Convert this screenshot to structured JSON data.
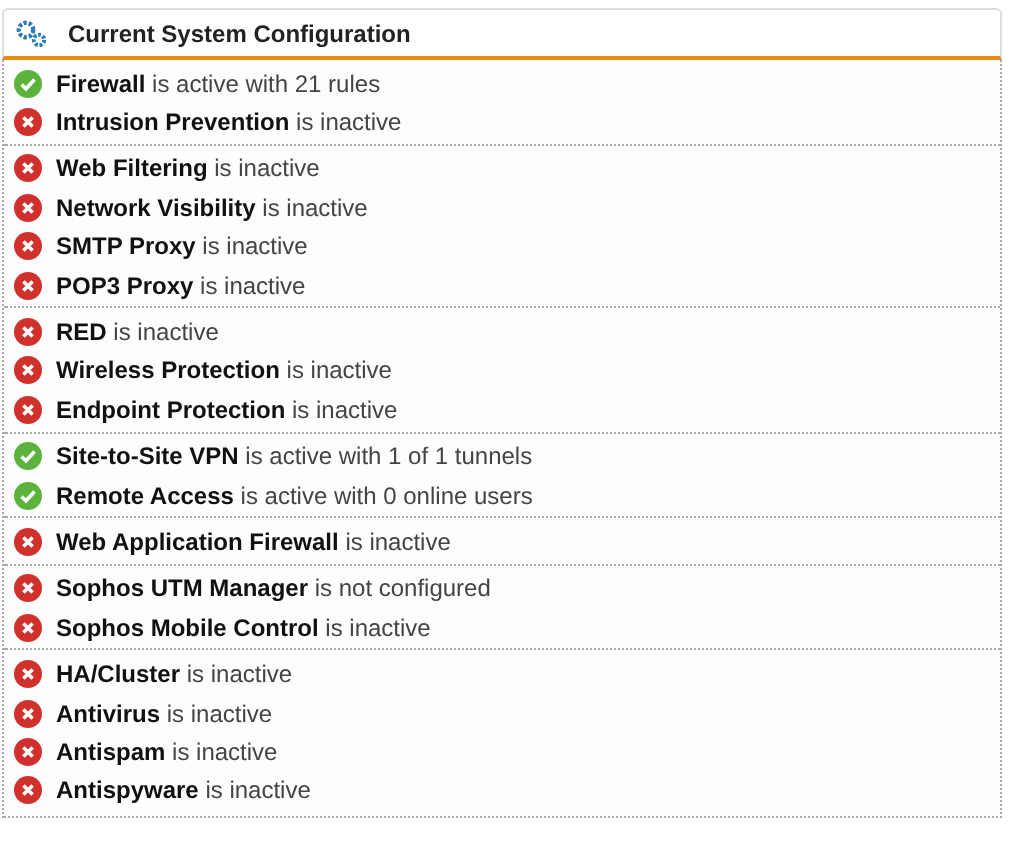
{
  "panel": {
    "title": "Current System Configuration"
  },
  "groups": [
    {
      "items": [
        {
          "text": "**Firewall** is active with 21 rules",
          "active": true
        },
        {
          "text": "**Intrusion Prevention** is inactive",
          "active": false
        }
      ]
    },
    {
      "items": [
        {
          "text": "**Web Filtering** is inactive",
          "active": false
        },
        {
          "text": "**Network Visibility** is inactive",
          "active": false
        },
        {
          "text": "**SMTP Proxy** is inactive",
          "active": false
        },
        {
          "text": "**POP3 Proxy** is inactive",
          "active": false
        }
      ]
    },
    {
      "items": [
        {
          "text": "**RED** is inactive",
          "active": false
        },
        {
          "text": "**Wireless Protection** is inactive",
          "active": false
        },
        {
          "text": "**Endpoint Protection** is inactive",
          "active": false
        }
      ]
    },
    {
      "items": [
        {
          "text": "**Site-to-Site VPN** is active with 1 of 1 tunnels",
          "active": true
        },
        {
          "text": "**Remote Access** is active with 0 online users",
          "active": true
        }
      ]
    },
    {
      "items": [
        {
          "text": "**Web Application Firewall** is inactive",
          "active": false
        }
      ]
    },
    {
      "items": [
        {
          "text": "**Sophos UTM Manager** is not configured",
          "active": false
        },
        {
          "text": "**Sophos Mobile Control** is inactive",
          "active": false
        }
      ]
    },
    {
      "items": [
        {
          "text": "**HA/Cluster** is inactive",
          "active": false
        },
        {
          "text": "**Antivirus** is inactive",
          "active": false
        },
        {
          "text": "**Antispam** is inactive",
          "active": false
        },
        {
          "text": "**Antispyware** is inactive",
          "active": false
        }
      ]
    }
  ]
}
